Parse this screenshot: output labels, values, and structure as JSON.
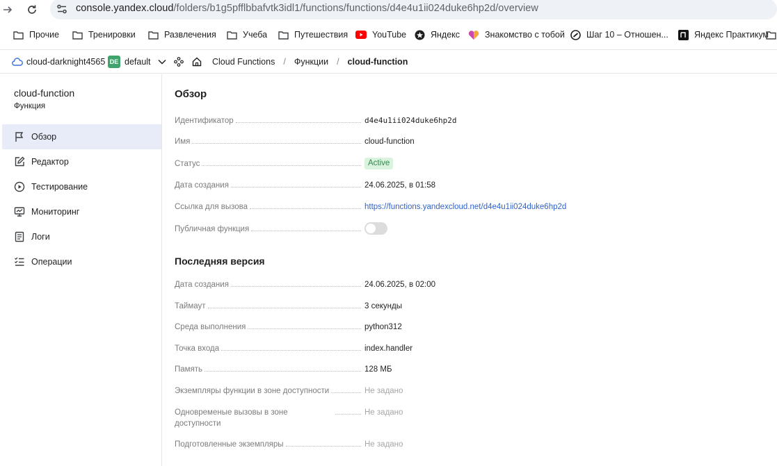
{
  "browser": {
    "url_host": "console.yandex.cloud",
    "url_path": "/folders/b1g5pfflbbafvtk3idl1/functions/functions/d4e4u1ii024duke6hp2d/overview",
    "bookmarks": [
      {
        "label": "Прочие",
        "icon": "folder-icon"
      },
      {
        "label": "Тренировки",
        "icon": "folder-icon"
      },
      {
        "label": "Развлечения",
        "icon": "folder-icon"
      },
      {
        "label": "Учеба",
        "icon": "folder-icon"
      },
      {
        "label": "Путешествия",
        "icon": "folder-icon"
      },
      {
        "label": "YouTube",
        "icon": "youtube-icon"
      },
      {
        "label": "Яндекс",
        "icon": "yandex-icon"
      },
      {
        "label": "Знакомство с тобой",
        "icon": "heart-icon"
      },
      {
        "label": "Шаг 10 – Отношен...",
        "icon": "spiral-icon"
      },
      {
        "label": "Яндекс Практикум",
        "icon": "practicum-icon"
      }
    ]
  },
  "topbar": {
    "cloud": "cloud-darknight4565",
    "folder_badge": "DE",
    "folder": "default",
    "breadcrumbs": [
      "Cloud Functions",
      "Функции",
      "cloud-function"
    ],
    "separator": "/"
  },
  "sidebar": {
    "title": "cloud-function",
    "subtitle": "Функция",
    "items": [
      {
        "label": "Обзор",
        "icon": "flag-icon",
        "active": true
      },
      {
        "label": "Редактор",
        "icon": "edit-icon",
        "active": false
      },
      {
        "label": "Тестирование",
        "icon": "play-circle-icon",
        "active": false
      },
      {
        "label": "Мониторинг",
        "icon": "monitoring-icon",
        "active": false
      },
      {
        "label": "Логи",
        "icon": "logs-icon",
        "active": false
      },
      {
        "label": "Операции",
        "icon": "list-check-icon",
        "active": false
      }
    ]
  },
  "overview": {
    "title": "Обзор",
    "rows": [
      {
        "key": "Идентификатор",
        "value": "d4e4u1ii024duke6hp2d"
      },
      {
        "key": "Имя",
        "value": "cloud-function"
      },
      {
        "key": "Статус",
        "value": "Active"
      },
      {
        "key": "Дата создания",
        "value": "24.06.2025, в 01:58"
      },
      {
        "key": "Ссылка для вызова",
        "value": "https://functions.yandexcloud.net/d4e4u1ii024duke6hp2d"
      },
      {
        "key": "Публичная функция",
        "value": "off"
      }
    ]
  },
  "version": {
    "title": "Последняя версия",
    "rows": [
      {
        "key": "Дата создания",
        "value": "24.06.2025, в 02:00"
      },
      {
        "key": "Таймаут",
        "value": "3 секунды"
      },
      {
        "key": "Среда выполнения",
        "value": "python312"
      },
      {
        "key": "Точка входа",
        "value": "index.handler"
      },
      {
        "key": "Память",
        "value": "128 МБ"
      },
      {
        "key": "Экземпляры функции в зоне доступности",
        "value": "Не задано"
      },
      {
        "key": "Одновременые вызовы в зоне доступности",
        "value": "Не задано"
      },
      {
        "key": "Подготовленные экземпляры",
        "value": "Не задано"
      }
    ]
  },
  "colors": {
    "accent": "#2f63c9",
    "active_nav_bg": "#e7ecf8",
    "status_bg": "#daf3df",
    "status_text": "#2e8b4e",
    "folder_badge_bg": "#3fa36b"
  }
}
